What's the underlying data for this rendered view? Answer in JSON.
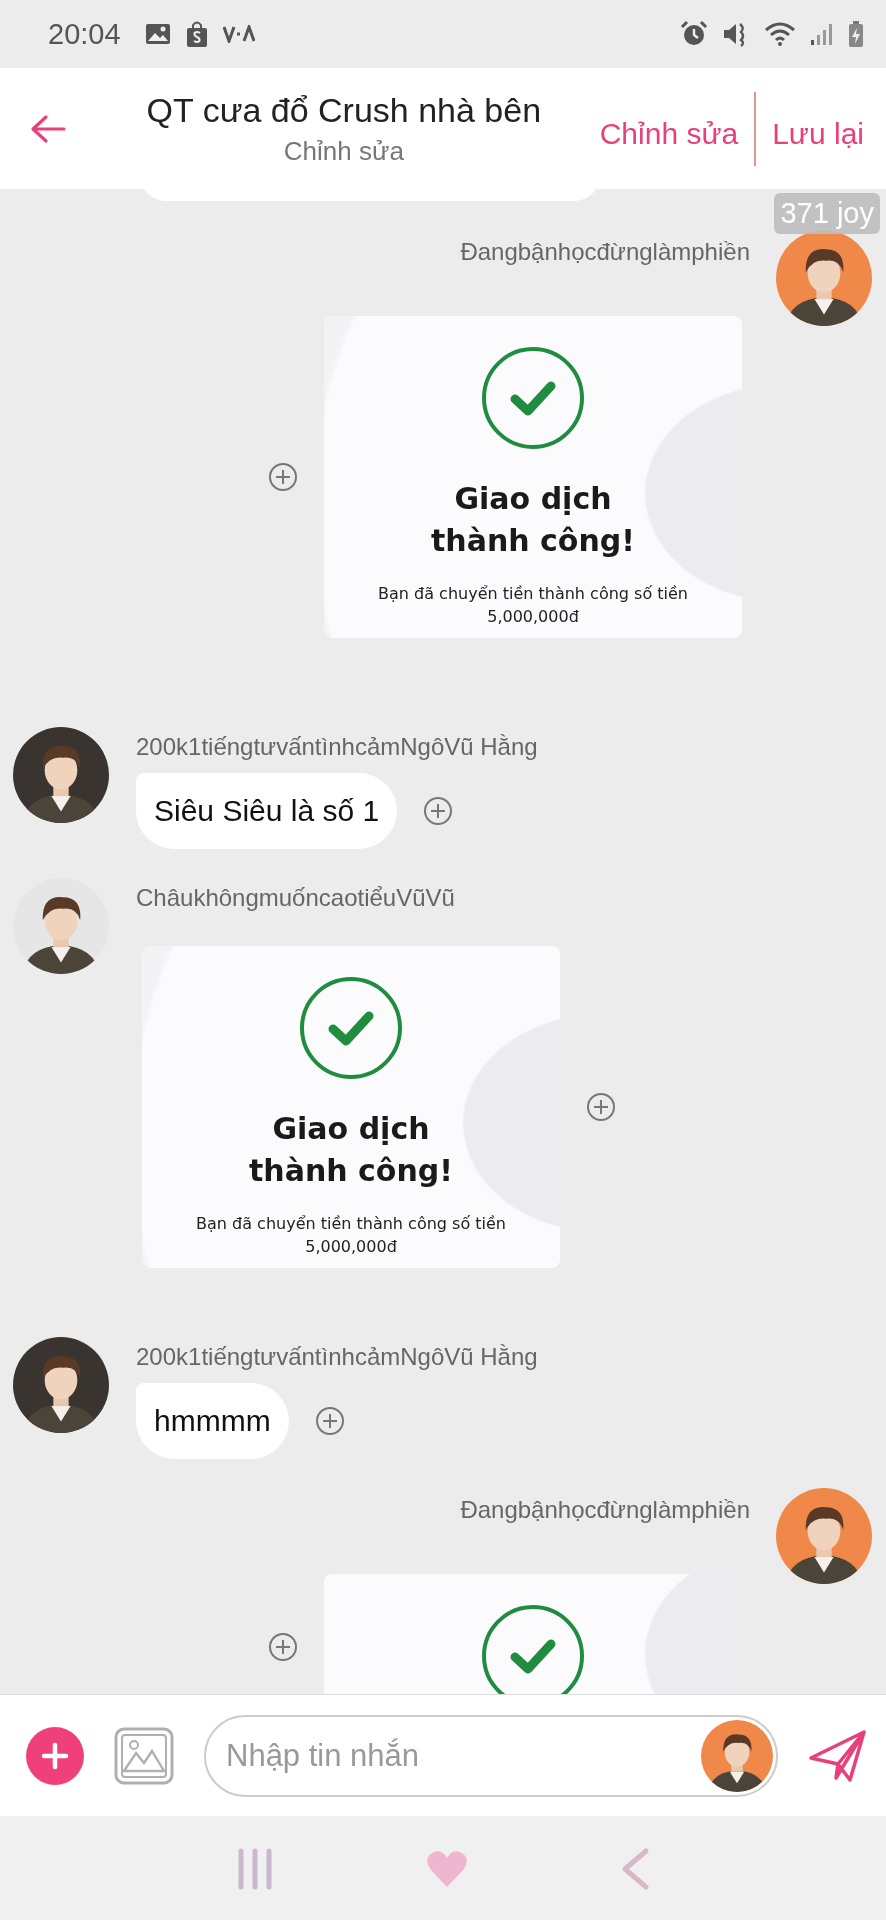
{
  "status_bar": {
    "time": "20:04"
  },
  "header": {
    "title": "QT cưa đổ Crush nhà bên",
    "subtitle": "Chỉnh sửa",
    "actions": [
      "Chỉnh sửa",
      "Lưu lại"
    ]
  },
  "badge": "371 joy",
  "messages": [
    {
      "kind": "partial"
    },
    {
      "kind": "transfer",
      "outgoing": true,
      "sender": "Đangbậnhọcđừnglàmphiền",
      "title": "Giao dịch",
      "title_2": "thành công!",
      "body": "Bạn đã chuyển tiền thành công số tiền",
      "amount": "5,000,000đ"
    },
    {
      "kind": "text",
      "outgoing": false,
      "sender": "200k1tiếngtưvấntìnhcảmNgôVũ Hằng",
      "text": "Siêu Siêu là số 1"
    },
    {
      "kind": "transfer",
      "outgoing": false,
      "sender": "ChâukhôngmuốncaotiểuVũVũ",
      "title": "Giao dịch",
      "title_2": "thành công!",
      "body": "Bạn đã chuyển tiền thành công số tiền",
      "amount": "5,000,000đ"
    },
    {
      "kind": "text",
      "outgoing": false,
      "sender": "200k1tiếngtưvấntìnhcảmNgôVũ Hằng",
      "text": "hmmmm"
    },
    {
      "kind": "transfer",
      "outgoing": true,
      "sender": "Đangbậnhọcđừnglàmphiền"
    }
  ],
  "composer": {
    "placeholder": "Nhập tin nhắn"
  }
}
